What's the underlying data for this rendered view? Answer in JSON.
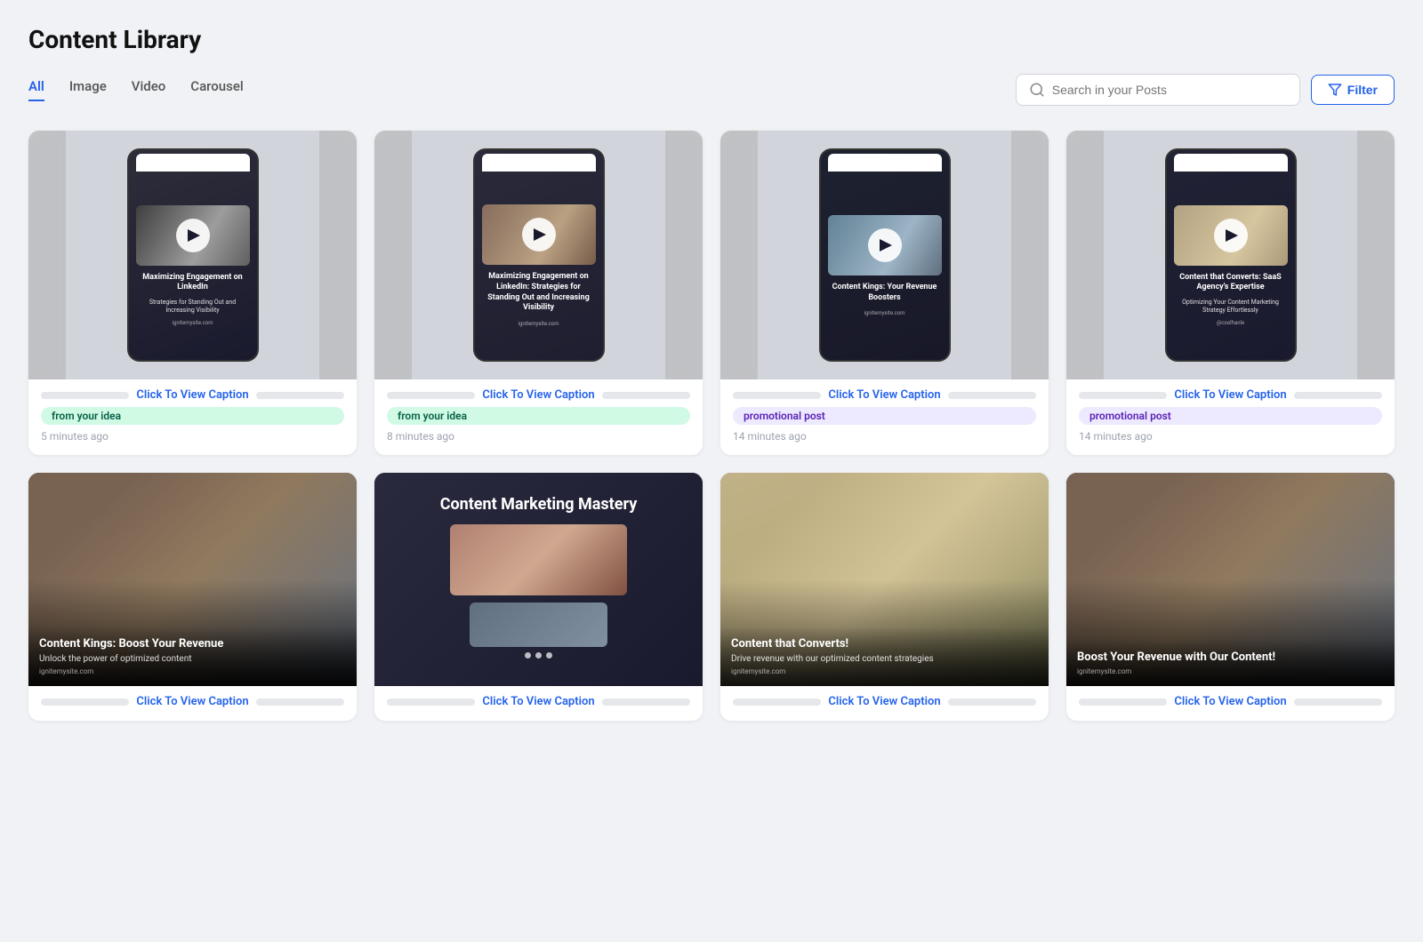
{
  "page": {
    "title": "Content Library"
  },
  "tabs": [
    {
      "id": "all",
      "label": "All",
      "active": true
    },
    {
      "id": "image",
      "label": "Image",
      "active": false
    },
    {
      "id": "video",
      "label": "Video",
      "active": false
    },
    {
      "id": "carousel",
      "label": "Carousel",
      "active": false
    }
  ],
  "search": {
    "placeholder": "Search in your Posts"
  },
  "filter_button": "Filter",
  "caption_label": "Click To View Caption",
  "cards": [
    {
      "id": 1,
      "type": "video",
      "title": "Maximizing Engagement on LinkedIn",
      "subtitle": "Strategies for Standing Out and Increasing Visibility",
      "domain": "ignitemysite.com",
      "badge": "from your idea",
      "badge_type": "green",
      "time": "5 minutes ago"
    },
    {
      "id": 2,
      "type": "video",
      "title": "Maximizing Engagement on LinkedIn: Strategies for Standing Out and Increasing Visibility",
      "subtitle": "",
      "domain": "ignitemysite.com",
      "badge": "from your idea",
      "badge_type": "green",
      "time": "8 minutes ago"
    },
    {
      "id": 3,
      "type": "video",
      "title": "Content Kings: Your Revenue Boosters",
      "subtitle": "",
      "domain": "ignitemysite.com",
      "badge": "promotional post",
      "badge_type": "purple",
      "time": "14 minutes ago"
    },
    {
      "id": 4,
      "type": "video",
      "title": "Content that Converts: SaaS Agency's Expertise",
      "subtitle": "Optimizing Your Content Marketing Strategy Effortlessly",
      "domain": "@coolhanle",
      "badge": "promotional post",
      "badge_type": "purple",
      "time": "14 minutes ago"
    },
    {
      "id": 5,
      "type": "image",
      "title": "Content Kings: Boost Your Revenue",
      "subtitle": "Unlock the power of optimized content",
      "domain": "ignitemysite.com",
      "badge": "",
      "badge_type": "",
      "time": ""
    },
    {
      "id": 6,
      "type": "carousel",
      "title": "Content Marketing Mastery",
      "subtitle": "",
      "domain": "",
      "badge": "",
      "badge_type": "",
      "time": ""
    },
    {
      "id": 7,
      "type": "image",
      "title": "Content that Converts!",
      "subtitle": "Drive revenue with our optimized content strategies",
      "domain": "ignitemysite.com",
      "badge": "",
      "badge_type": "",
      "time": ""
    },
    {
      "id": 8,
      "type": "image",
      "title": "Boost Your Revenue with Our Content!",
      "subtitle": "",
      "domain": "ignitemysite.com",
      "badge": "",
      "badge_type": "",
      "time": ""
    }
  ]
}
